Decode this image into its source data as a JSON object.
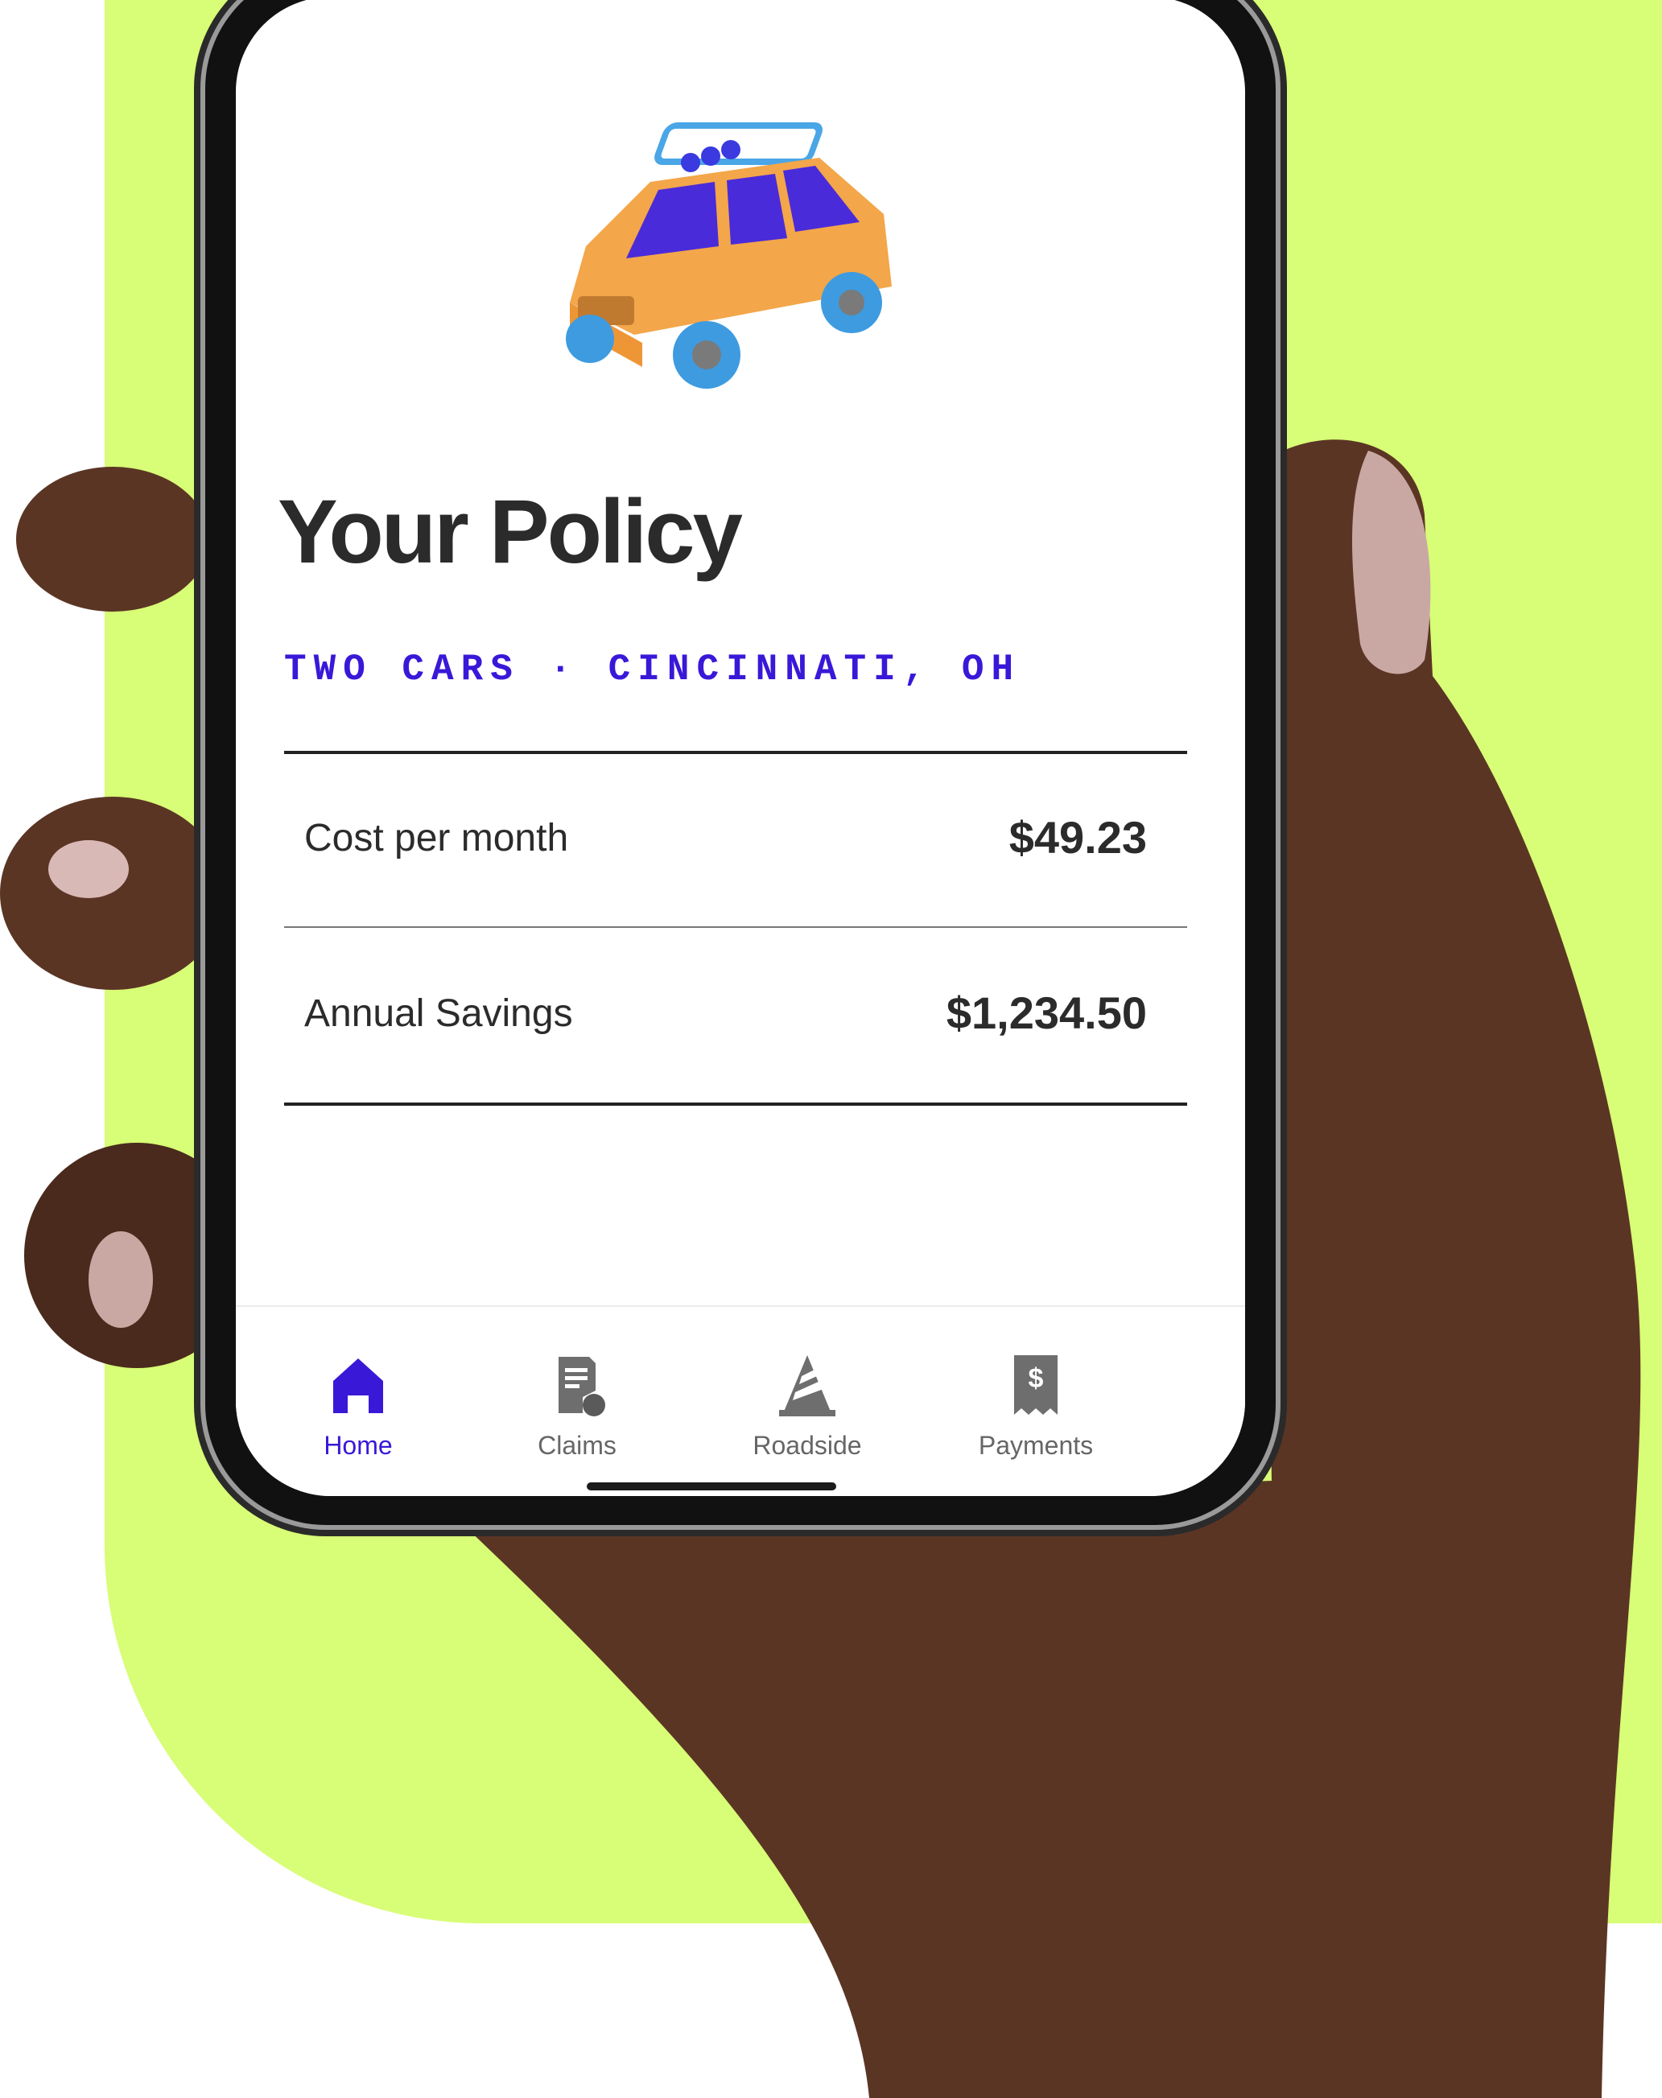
{
  "policy": {
    "title": "Your Policy",
    "subtitle": "TWO CARS · CINCINNATI, OH",
    "rows": [
      {
        "label": "Cost per month",
        "value": "$49.23"
      },
      {
        "label": "Annual Savings",
        "value": "$1,234.50"
      }
    ]
  },
  "nav": {
    "tabs": [
      {
        "label": "Home",
        "icon": "home-icon",
        "active": true
      },
      {
        "label": "Claims",
        "icon": "claims-document-icon",
        "active": false
      },
      {
        "label": "Roadside",
        "icon": "traffic-cone-icon",
        "active": false
      },
      {
        "label": "Payments",
        "icon": "receipt-dollar-icon",
        "active": false
      }
    ]
  },
  "colors": {
    "accent": "#3a18d8",
    "backdrop": "#d8fd76",
    "text": "#2b2b2b",
    "inactive_icon": "#6e6e6e"
  }
}
